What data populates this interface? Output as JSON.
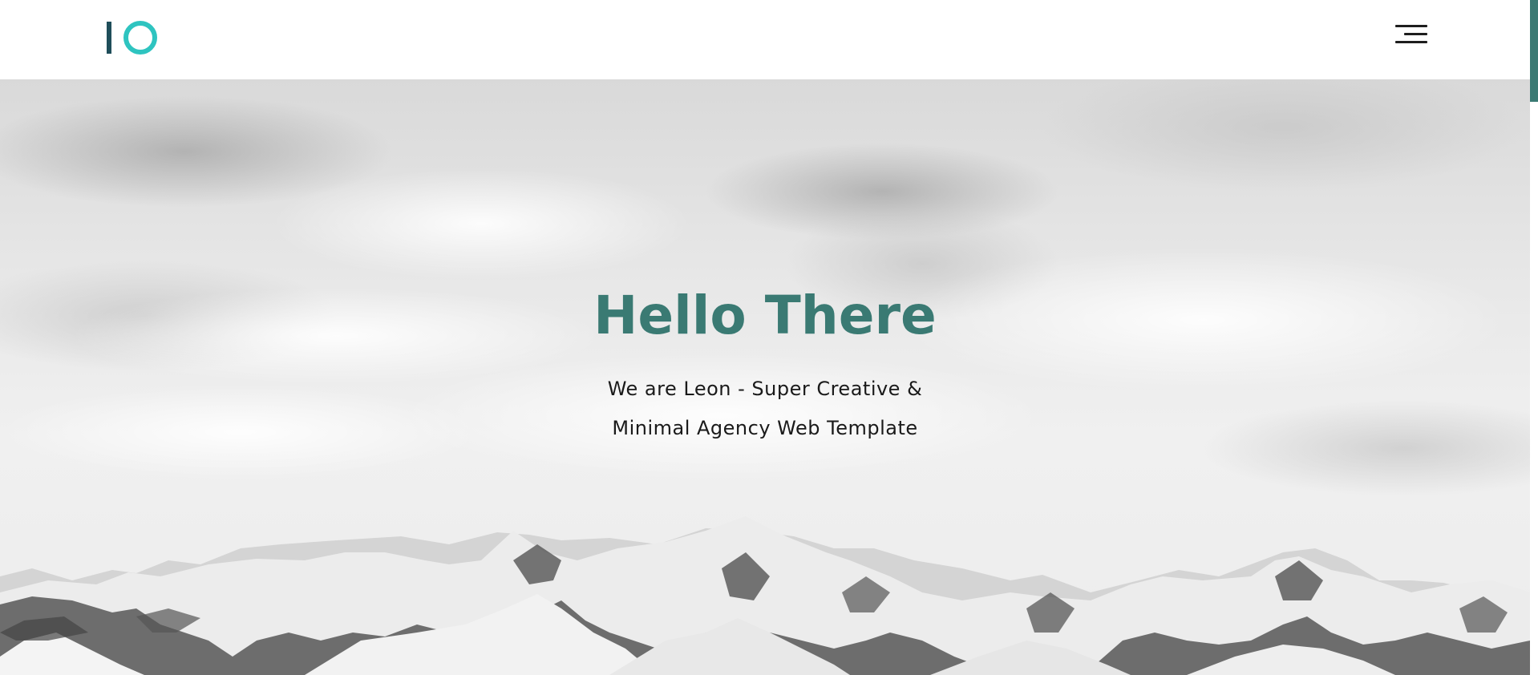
{
  "header": {
    "logo_icon": "io-logo-icon",
    "menu_icon": "hamburger-menu-icon"
  },
  "hero": {
    "title": "Hello There",
    "subtitle_line1": "We are Leon - Super Creative &",
    "subtitle_line2": "Minimal Agency Web Template",
    "background_icon": "snowy-mountains-photo"
  },
  "colors": {
    "accent": "#3a7a73",
    "logo_ring": "#2ec4c0",
    "logo_bar": "#1f4e5a",
    "text": "#1a1a1a"
  },
  "scrollbar": {
    "scroll_fraction": 0.0
  }
}
